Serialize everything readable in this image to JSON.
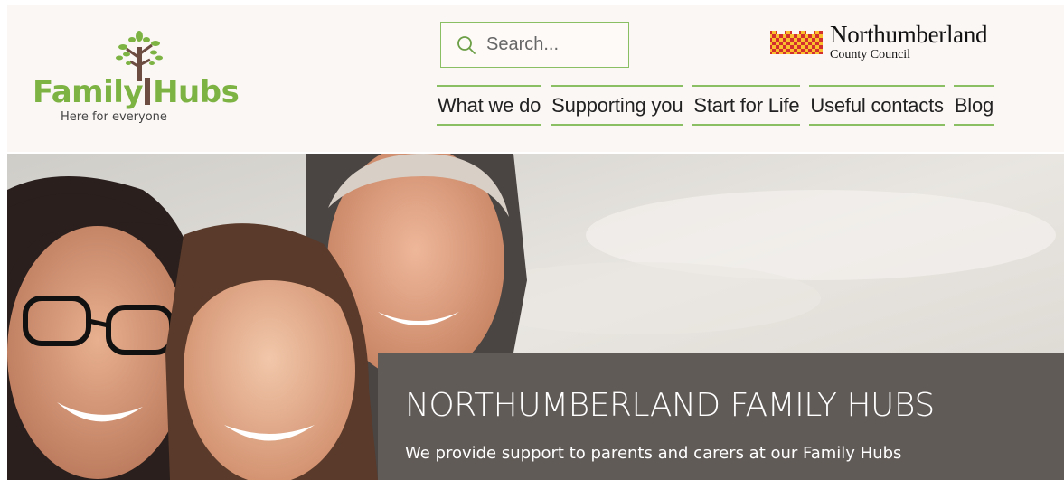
{
  "logo": {
    "word_left": "Family",
    "word_right": "Hubs",
    "tagline": "Here for everyone"
  },
  "search": {
    "placeholder": "Search..."
  },
  "council": {
    "name": "Northumberland",
    "subtitle": "County Council"
  },
  "nav": {
    "items": [
      {
        "label": "What we do"
      },
      {
        "label": "Supporting you"
      },
      {
        "label": "Start for Life"
      },
      {
        "label": "Useful contacts"
      },
      {
        "label": "Blog"
      }
    ]
  },
  "hero": {
    "title": "NORTHUMBERLAND FAMILY HUBS",
    "text": "We provide support to parents and carers at our Family Hubs"
  },
  "colors": {
    "accent_green": "#8bbf63",
    "logo_green": "#7cb342",
    "header_bg": "#fbf7f5",
    "hero_box": "#615b58",
    "council_red": "#d32f2f",
    "council_yellow": "#fbc02d"
  }
}
